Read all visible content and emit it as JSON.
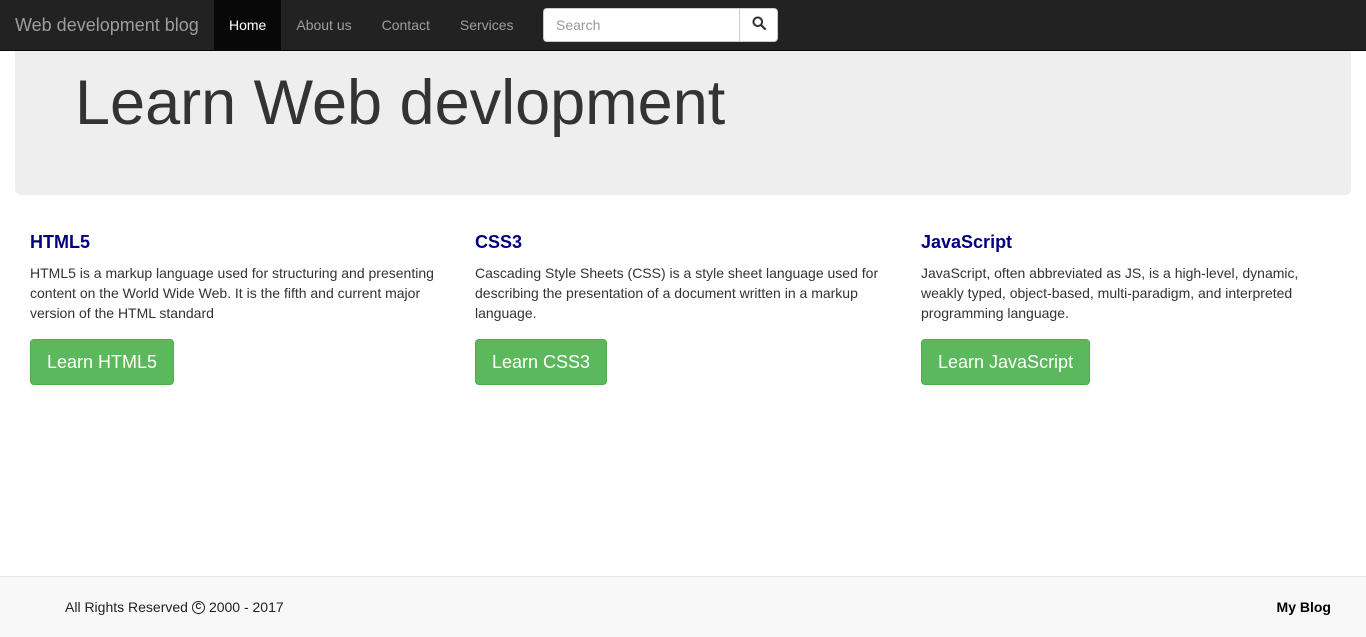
{
  "navbar": {
    "brand": "Web development blog",
    "items": [
      {
        "label": "Home",
        "active": true
      },
      {
        "label": "About us",
        "active": false
      },
      {
        "label": "Contact",
        "active": false
      },
      {
        "label": "Services",
        "active": false
      }
    ],
    "search": {
      "placeholder": "Search",
      "value": "",
      "button_icon": "search-icon"
    }
  },
  "jumbotron": {
    "title": "Learn Web devlopment"
  },
  "columns": [
    {
      "heading": "HTML5",
      "text": "HTML5 is a markup language used for structuring and presenting content on the World Wide Web. It is the fifth and current major version of the HTML standard",
      "button": "Learn HTML5"
    },
    {
      "heading": "CSS3",
      "text": "Cascading Style Sheets (CSS) is a style sheet language used for describing the presentation of a document written in a markup language.",
      "button": "Learn CSS3"
    },
    {
      "heading": "JavaScript",
      "text": "JavaScript, often abbreviated as JS, is a high-level, dynamic, weakly typed, object-based, multi-paradigm, and interpreted programming language.",
      "button": "Learn JavaScript"
    }
  ],
  "footer": {
    "copyright_prefix": "All Rights Reserved",
    "copyright_icon": "copyright-icon",
    "copyright_years": "2000 - 2017",
    "brand": "My Blog"
  },
  "colors": {
    "navbar_bg": "#222222",
    "heading": "#000080",
    "button_success": "#5cb85c"
  }
}
